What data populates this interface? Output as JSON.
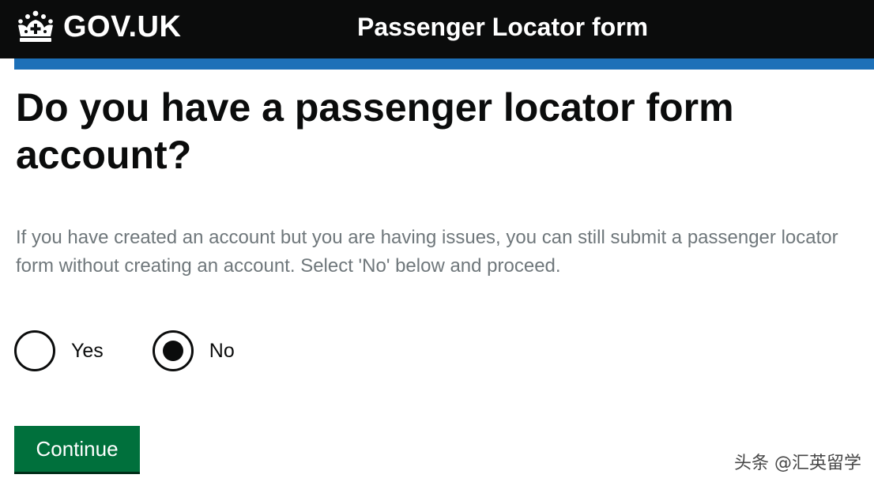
{
  "header": {
    "logo_text": "GOV.UK",
    "logo_icon": "crown-icon",
    "service_name": "Passenger Locator form",
    "background_color": "#0b0c0c",
    "accent_bar_color": "#1d70b8"
  },
  "main": {
    "heading": "Do you have a passenger locator form account?",
    "hint": "If you have created an account but you are having issues, you can still submit a passenger locator form without creating an account. Select 'No' below and proceed.",
    "options": [
      {
        "label": "Yes",
        "selected": false
      },
      {
        "label": "No",
        "selected": true
      }
    ],
    "continue_label": "Continue",
    "button_color": "#00703c"
  },
  "watermark": "头条 @汇英留学"
}
